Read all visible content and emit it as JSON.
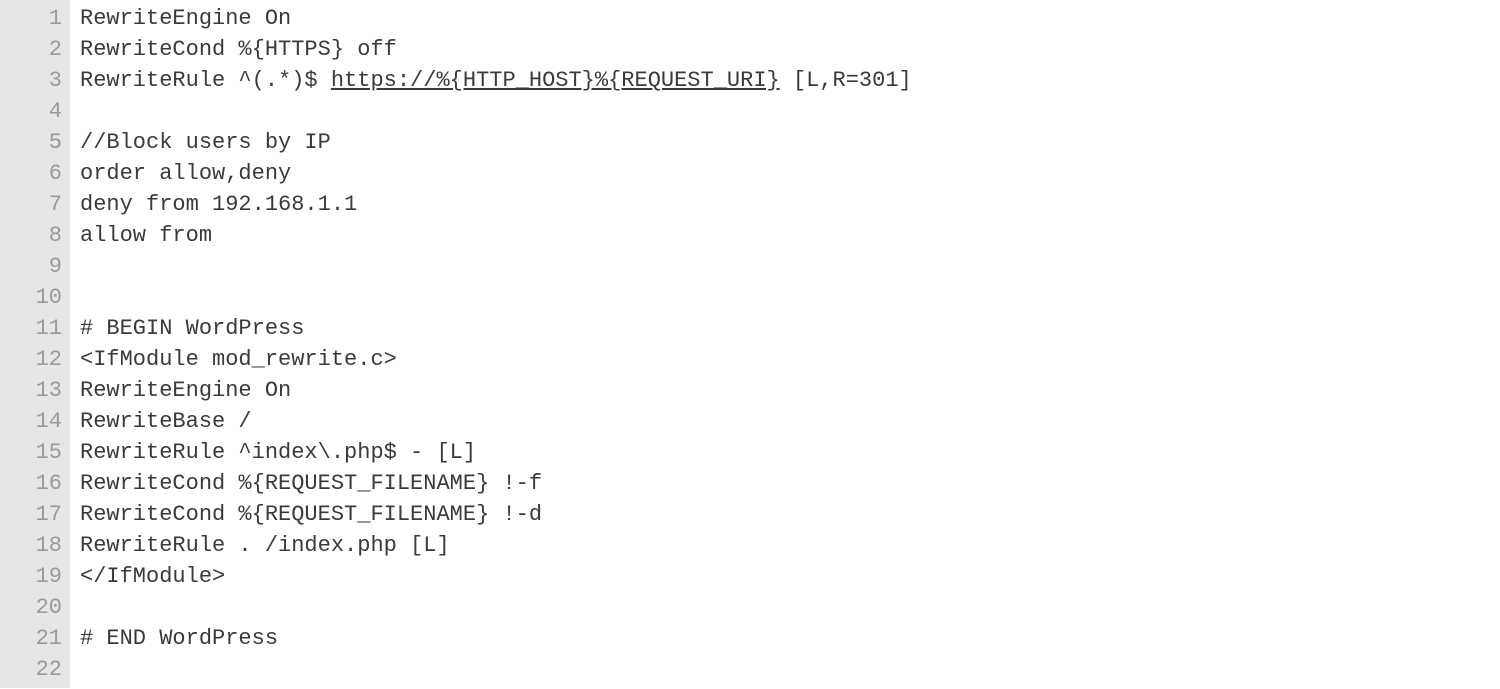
{
  "lines": [
    {
      "num": "1",
      "segments": [
        {
          "text": "RewriteEngine On"
        }
      ]
    },
    {
      "num": "2",
      "segments": [
        {
          "text": "RewriteCond %{HTTPS} off"
        }
      ]
    },
    {
      "num": "3",
      "segments": [
        {
          "text": "RewriteRule ^(.*)$ "
        },
        {
          "text": "https://%{HTTP_HOST}%{REQUEST_URI}",
          "link": true
        },
        {
          "text": " [L,R=301]"
        }
      ]
    },
    {
      "num": "4",
      "segments": [
        {
          "text": ""
        }
      ]
    },
    {
      "num": "5",
      "segments": [
        {
          "text": "//Block users by IP"
        }
      ]
    },
    {
      "num": "6",
      "segments": [
        {
          "text": "order allow,deny"
        }
      ]
    },
    {
      "num": "7",
      "segments": [
        {
          "text": "deny from 192.168.1.1"
        }
      ]
    },
    {
      "num": "8",
      "segments": [
        {
          "text": "allow from"
        }
      ]
    },
    {
      "num": "9",
      "segments": [
        {
          "text": ""
        }
      ]
    },
    {
      "num": "10",
      "segments": [
        {
          "text": ""
        }
      ]
    },
    {
      "num": "11",
      "segments": [
        {
          "text": "# BEGIN WordPress"
        }
      ]
    },
    {
      "num": "12",
      "segments": [
        {
          "text": "<IfModule mod_rewrite.c>"
        }
      ]
    },
    {
      "num": "13",
      "segments": [
        {
          "text": "RewriteEngine On"
        }
      ]
    },
    {
      "num": "14",
      "segments": [
        {
          "text": "RewriteBase /"
        }
      ]
    },
    {
      "num": "15",
      "segments": [
        {
          "text": "RewriteRule ^index\\.php$ - [L]"
        }
      ]
    },
    {
      "num": "16",
      "segments": [
        {
          "text": "RewriteCond %{REQUEST_FILENAME} !-f"
        }
      ]
    },
    {
      "num": "17",
      "segments": [
        {
          "text": "RewriteCond %{REQUEST_FILENAME} !-d"
        }
      ]
    },
    {
      "num": "18",
      "segments": [
        {
          "text": "RewriteRule . /index.php [L]"
        }
      ]
    },
    {
      "num": "19",
      "segments": [
        {
          "text": "</IfModule>"
        }
      ]
    },
    {
      "num": "20",
      "segments": [
        {
          "text": ""
        }
      ]
    },
    {
      "num": "21",
      "segments": [
        {
          "text": "# END WordPress"
        }
      ]
    },
    {
      "num": "22",
      "segments": [
        {
          "text": ""
        }
      ]
    }
  ]
}
